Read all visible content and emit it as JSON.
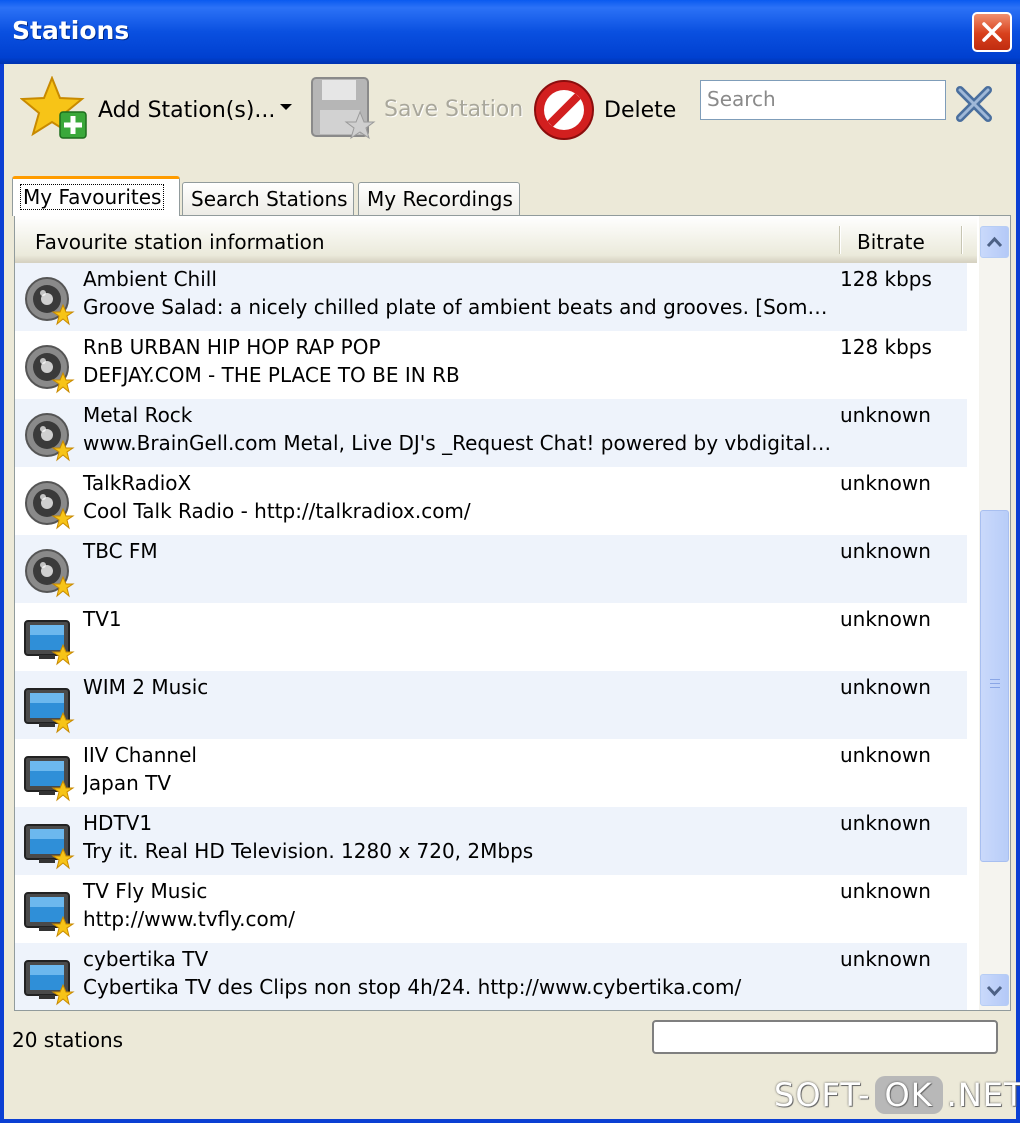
{
  "window": {
    "title": "Stations"
  },
  "toolbar": {
    "add_label": "Add Station(s)...",
    "save_label": "Save Station",
    "delete_label": "Delete",
    "search_placeholder": "Search",
    "search_value": ""
  },
  "tabs": [
    {
      "label": "My Favourites",
      "active": true
    },
    {
      "label": "Search Stations",
      "active": false
    },
    {
      "label": "My Recordings",
      "active": false
    }
  ],
  "columns": {
    "info": "Favourite station information",
    "bitrate": "Bitrate"
  },
  "stations": [
    {
      "type": "radio",
      "name": "Ambient Chill",
      "desc": "Groove Salad: a nicely chilled plate of ambient beats and grooves. [SomaFM",
      "bitrate": "128 kbps"
    },
    {
      "type": "radio",
      "name": "RnB URBAN HIP HOP RAP POP",
      "desc": "DEFJAY.COM - THE PLACE TO BE IN RB",
      "bitrate": "128 kbps"
    },
    {
      "type": "radio",
      "name": "Metal  Rock",
      "desc": "www.BrainGell.com Metal, Live DJ's _Request Chat! powered by vbdigital....",
      "bitrate": "unknown"
    },
    {
      "type": "radio",
      "name": "TalkRadioX",
      "desc": "Cool Talk Radio - http://talkradiox.com/",
      "bitrate": "unknown"
    },
    {
      "type": "radio",
      "name": "TBC FM",
      "desc": "",
      "bitrate": "unknown"
    },
    {
      "type": "tv",
      "name": "TV1",
      "desc": "",
      "bitrate": "unknown"
    },
    {
      "type": "tv",
      "name": "WIM 2 Music",
      "desc": "",
      "bitrate": "unknown"
    },
    {
      "type": "tv",
      "name": "IIV Channel",
      "desc": "Japan TV",
      "bitrate": "unknown"
    },
    {
      "type": "tv",
      "name": "HDTV1",
      "desc": "Try it. Real HD Television. 1280 x 720, 2Mbps",
      "bitrate": "unknown"
    },
    {
      "type": "tv",
      "name": "TV Fly Music",
      "desc": "http://www.tvfly.com/",
      "bitrate": "unknown"
    },
    {
      "type": "tv",
      "name": "cybertika TV",
      "desc": "Cybertika TV des Clips non stop 4h/24. http://www.cybertika.com/",
      "bitrate": "unknown"
    }
  ],
  "status": {
    "count": "20 stations",
    "progress": 0
  },
  "watermark": {
    "left": "SOFT-",
    "mid": "OK",
    "right": ".NET"
  },
  "colors": {
    "titlebar": "#0a50e0",
    "row_alt": "#eef3fb",
    "active_tab_accent": "#ff9c00"
  }
}
